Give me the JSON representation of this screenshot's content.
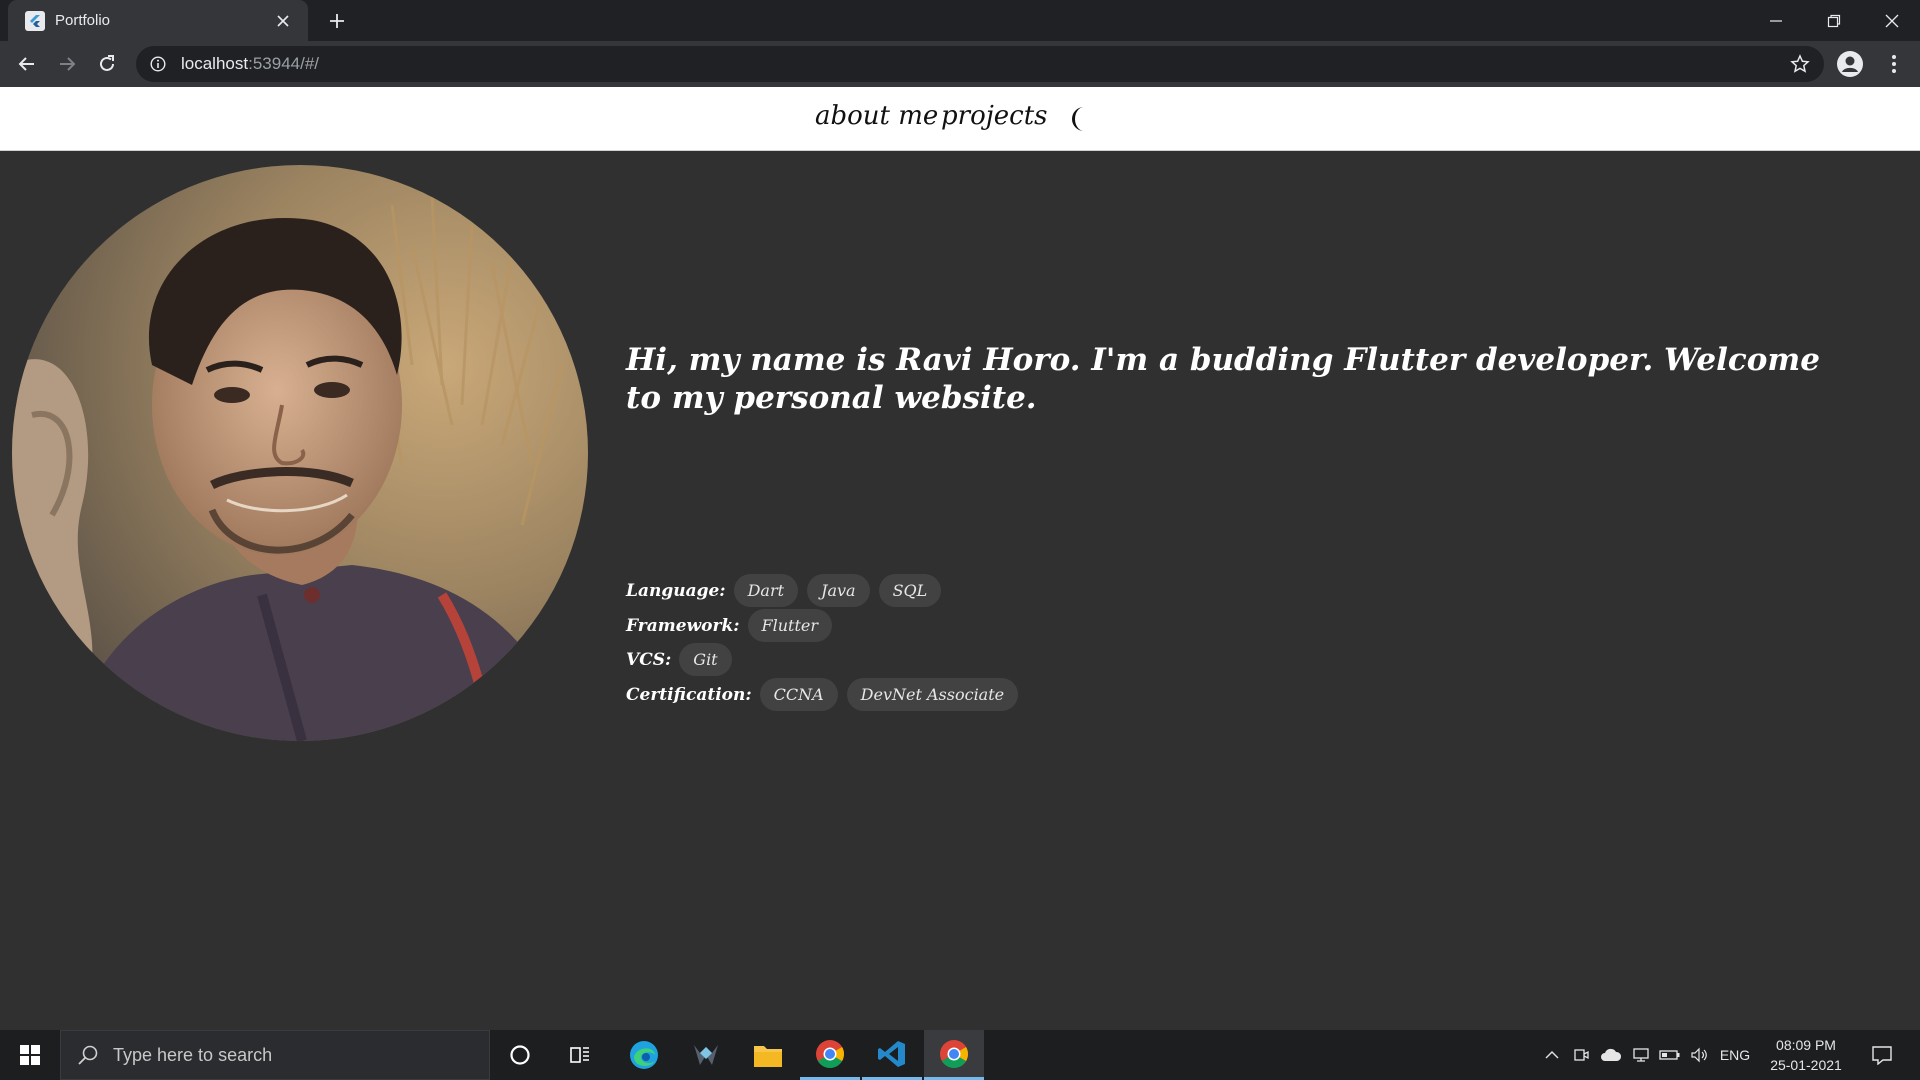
{
  "browser": {
    "tab_title": "Portfolio",
    "url_host": "localhost",
    "url_rest": ":53944/#/"
  },
  "appbar": {
    "links": [
      "about me",
      "projects"
    ],
    "theme_toggle_icon": "moon-icon"
  },
  "profile": {
    "intro": "Hi, my name is Ravi Horo. I'm a budding Flutter developer. Welcome to my personal website.",
    "skills": [
      {
        "label": "Language:",
        "chips": [
          "Dart",
          "Java",
          "SQL"
        ]
      },
      {
        "label": "Framework:",
        "chips": [
          "Flutter"
        ]
      },
      {
        "label": "VCS:",
        "chips": [
          "Git"
        ]
      },
      {
        "label": "Certification:",
        "chips": [
          "CCNA",
          "DevNet Associate"
        ]
      }
    ]
  },
  "taskbar": {
    "search_placeholder": "Type here to search",
    "language": "ENG",
    "time": "08:09 PM",
    "date": "25-01-2021",
    "apps": [
      "cortana-icon",
      "task-view-icon",
      "edge-icon",
      "predator-icon",
      "file-explorer-icon",
      "chrome-icon",
      "vscode-icon",
      "chrome-icon"
    ]
  },
  "colors": {
    "page_background": "#303030",
    "appbar_background": "#ffffff",
    "chip_background": "#424242",
    "text": "#ffffff"
  }
}
